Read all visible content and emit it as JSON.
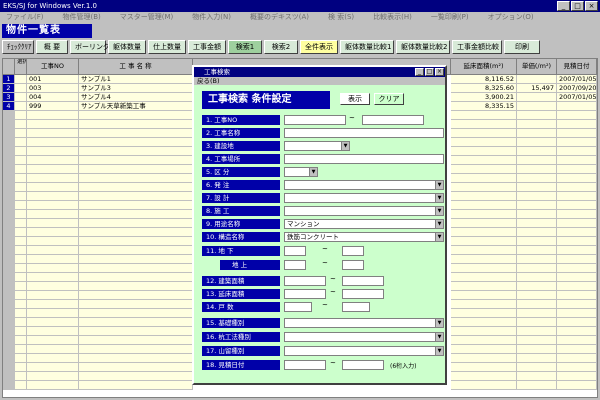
{
  "window": {
    "title": "EKS/SJ for Windows Ver.1.0"
  },
  "menu": [
    "ファイル(F)",
    "物件管理(B)",
    "マスター管理(M)",
    "物件入力(N)",
    "概要のデキスツ(A)",
    "検 索(S)",
    "比較表示(H)",
    "一覧印刷(P)",
    "オプション(O)"
  ],
  "page_title": "物件一覧表",
  "toolbar": [
    {
      "label": "ﾁｪｯｸｸﾘｱ",
      "style": "gray"
    },
    {
      "label": "概 要",
      "style": ""
    },
    {
      "label": "ボーリング",
      "style": ""
    },
    {
      "label": "躯体数量",
      "style": ""
    },
    {
      "label": "仕上数量",
      "style": ""
    },
    {
      "label": "工事金額",
      "style": ""
    },
    {
      "label": "検索1",
      "style": "active"
    },
    {
      "label": "検索2",
      "style": ""
    },
    {
      "label": "全件表示",
      "style": "yellow"
    },
    {
      "label": "躯体数量比較1",
      "style": ""
    },
    {
      "label": "躯体数量比較2",
      "style": ""
    },
    {
      "label": "工事金額比較",
      "style": ""
    },
    {
      "label": "印刷",
      "style": ""
    }
  ],
  "grid": {
    "headers": {
      "sel": "選択",
      "no": "工事NO",
      "name": "工 事 名 称",
      "area": "延床面積(m²)",
      "unit": "単価(/m²)",
      "date": "見積日付"
    },
    "rows": [
      {
        "num": "1",
        "no": "001",
        "name": "サンプル1",
        "area": "8,116.52",
        "unit": "",
        "date": "2007/01/05"
      },
      {
        "num": "2",
        "no": "003",
        "name": "サンプル3",
        "area": "8,325.60",
        "unit": "15,497",
        "date": "2007/09/20"
      },
      {
        "num": "3",
        "no": "004",
        "name": "サンプル4",
        "area": "3,900.21",
        "unit": "",
        "date": "2007/01/05"
      },
      {
        "num": "4",
        "no": "999",
        "name": "サンプル天草新築工事",
        "area": "8,335.15",
        "unit": "",
        "date": ""
      }
    ]
  },
  "dialog": {
    "title": "工事検索",
    "menu": "戻る(B)",
    "heading": "工事検索  条件設定",
    "show_label": "表示",
    "clear_label": "クリア",
    "fields": {
      "f1": "1. 工事NO",
      "f2": "2. 工事名称",
      "f3": "3. 建設地",
      "f4": "4. 工事場所",
      "f5": "5. 区 分",
      "f6": "6. 発 注",
      "f7": "7. 設 計",
      "f8": "8. 施 工",
      "f9": "9. 用途名称",
      "f9v": "マンション",
      "f10": "10. 構造名称",
      "f10v": "鉄筋コンクリート",
      "f11": "11. 地 下",
      "f11b": "地 上",
      "f12": "12. 建築面積",
      "f13": "13. 延床面積",
      "f14": "14. 戸 数",
      "f15": "15. 基礎種別",
      "f16": "16. 杭工法種別",
      "f17": "17. 山留種別",
      "f18": "18. 見積日付",
      "tilde": "~",
      "date_note": "(6桁入力)"
    }
  }
}
